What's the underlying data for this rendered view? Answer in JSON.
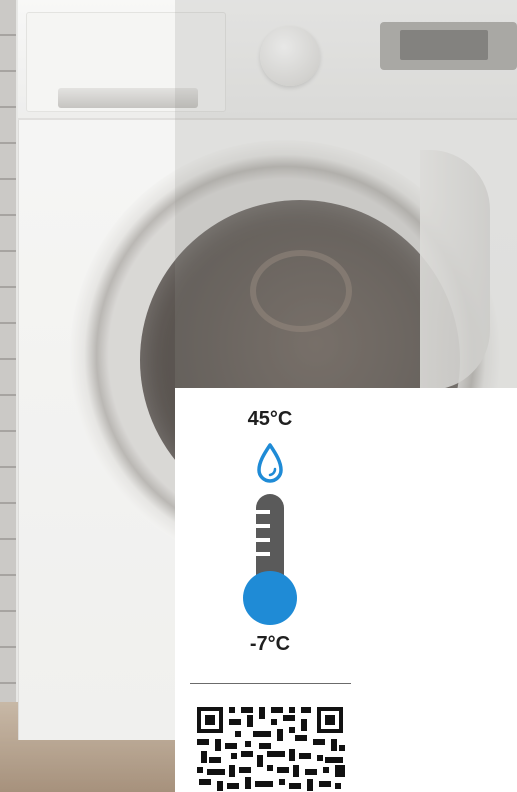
{
  "temperature": {
    "max_label": "45°C",
    "min_label": "-7°C"
  },
  "colors": {
    "accent_blue": "#1f8bd6",
    "thermometer_gray": "#5a5a5a",
    "panel_white": "#ffffff"
  },
  "icons": {
    "droplet": "water-droplet-icon",
    "thermometer": "thermometer-icon",
    "qr": "qr-code-icon"
  }
}
